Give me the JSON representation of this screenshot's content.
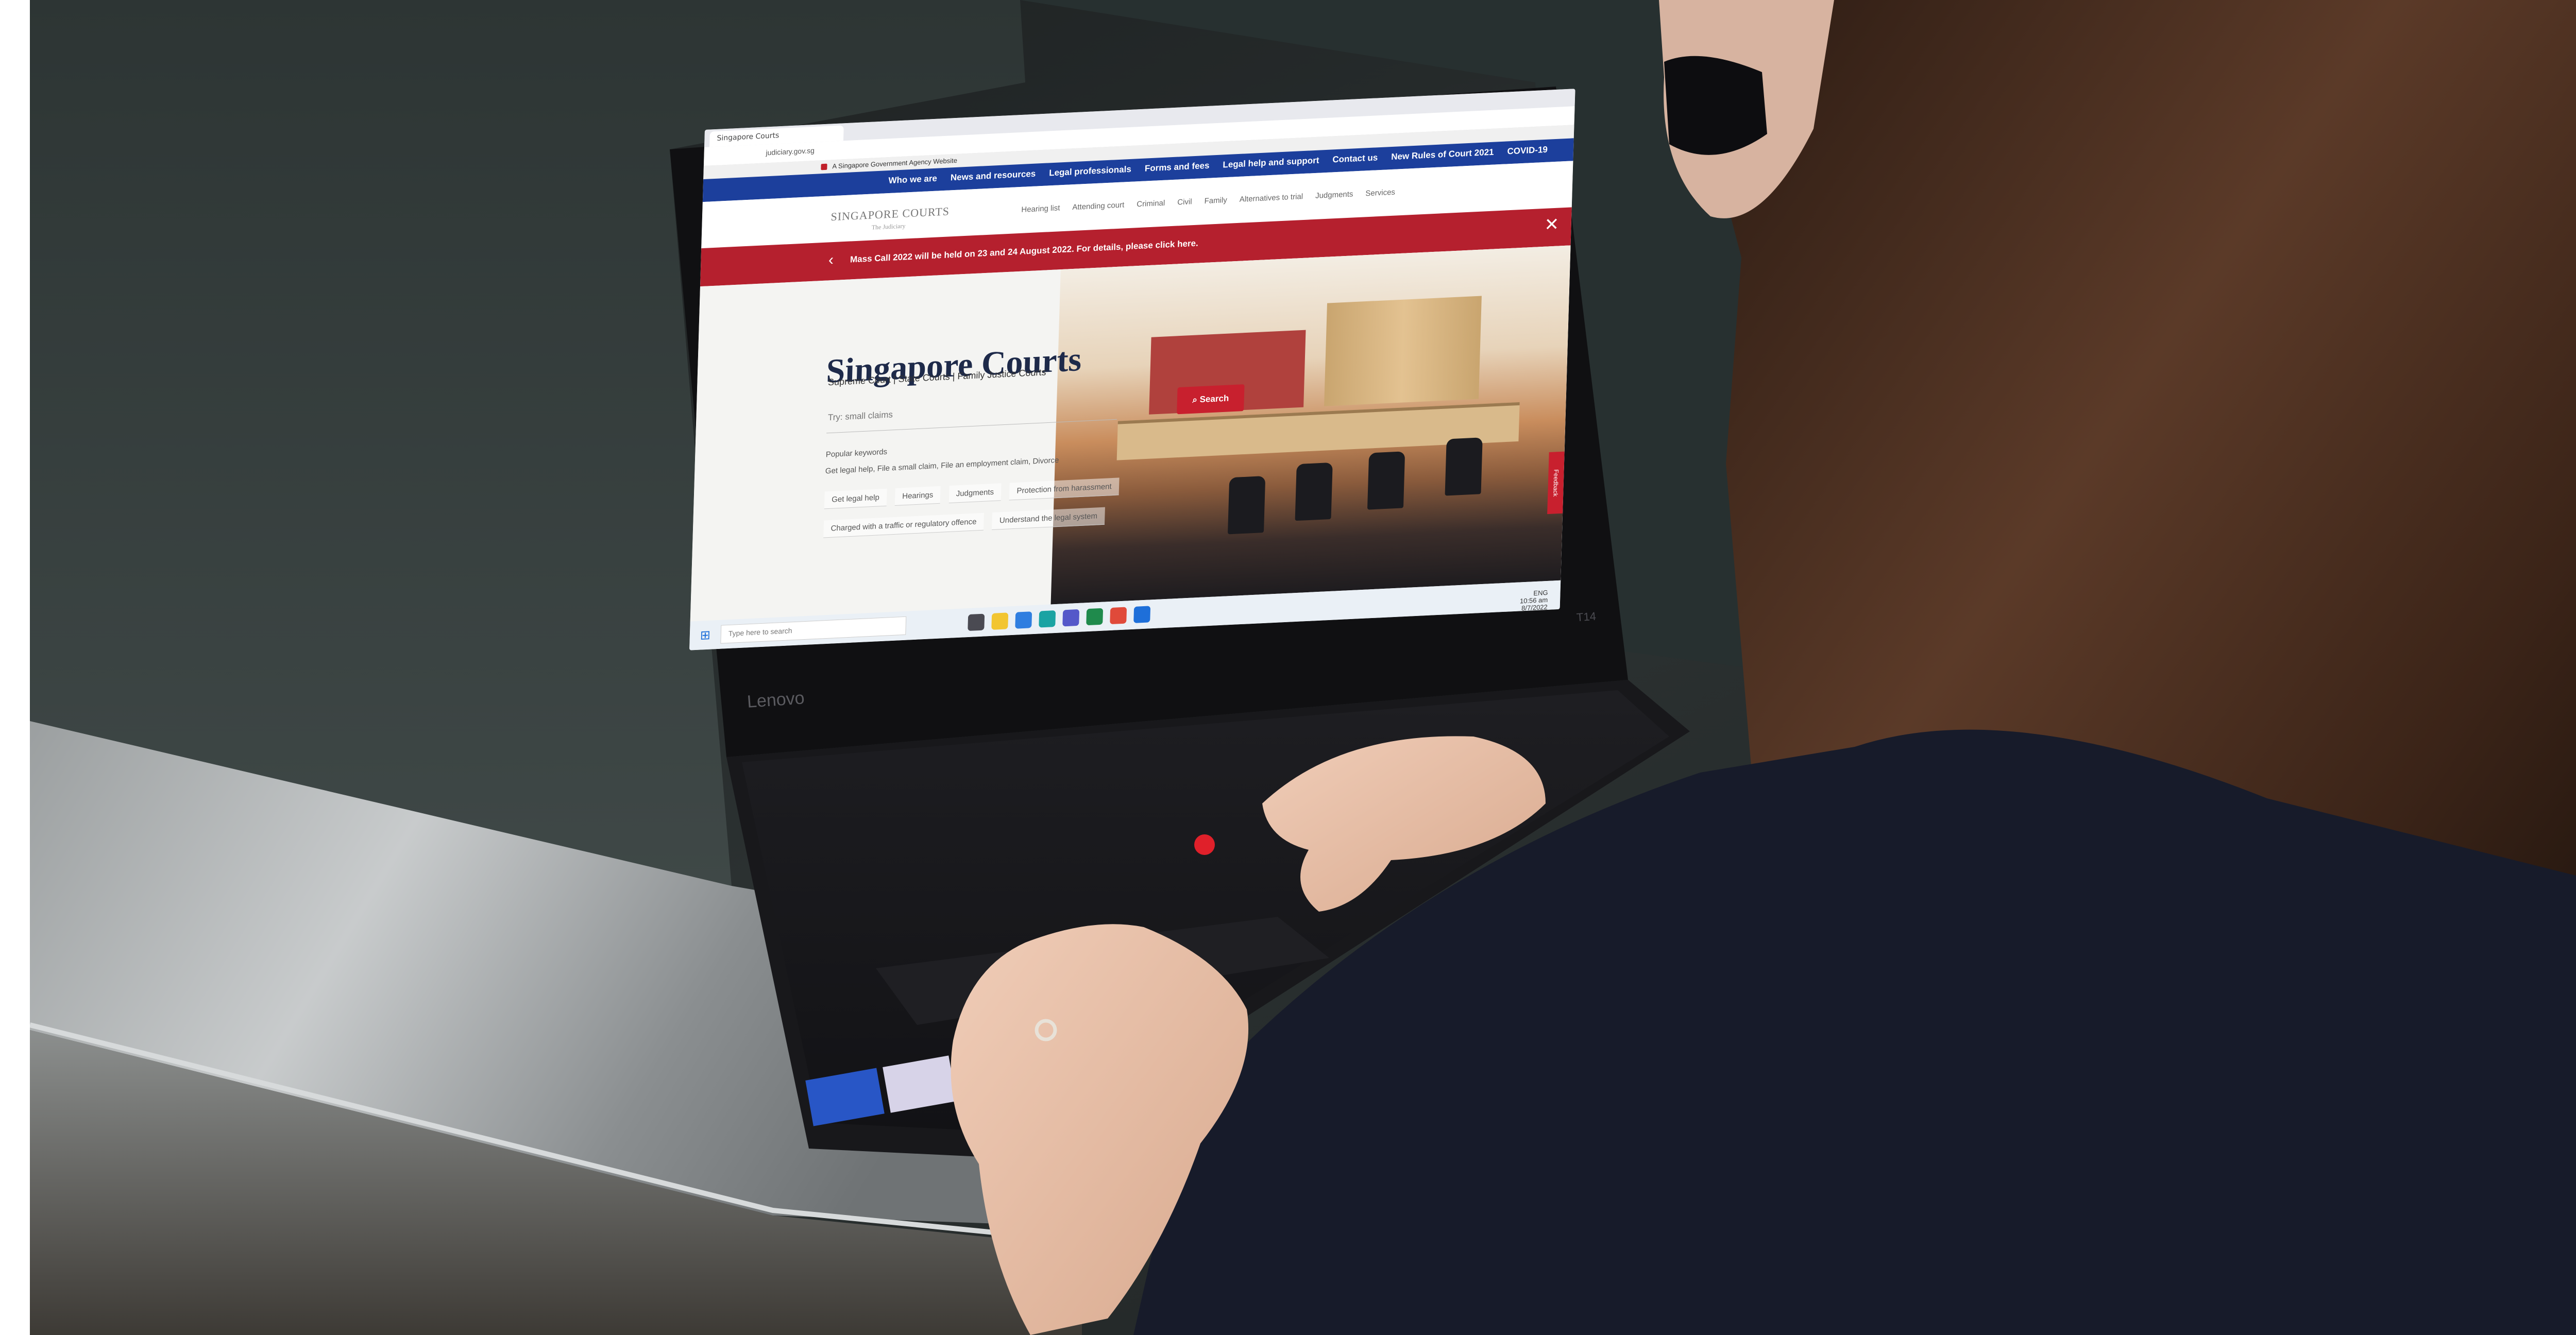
{
  "colors": {
    "nav_blue": "#1c3f9c",
    "brand_red": "#b5202e",
    "hero_title": "#1e2a4a"
  },
  "browser": {
    "tab_title": "Singapore Courts",
    "url": "judiciary.gov.sg"
  },
  "gov_strip": {
    "text": "A Singapore Government Agency Website"
  },
  "top_nav": [
    {
      "label": "Who we are"
    },
    {
      "label": "News and resources"
    },
    {
      "label": "Legal professionals"
    },
    {
      "label": "Forms and fees"
    },
    {
      "label": "Legal help and support"
    },
    {
      "label": "Contact us"
    },
    {
      "label": "New Rules of Court 2021"
    },
    {
      "label": "COVID-19"
    }
  ],
  "header": {
    "logo_text": "SINGAPORE COURTS",
    "logo_sub": "The Judiciary",
    "sub_nav": [
      {
        "label": "Hearing list"
      },
      {
        "label": "Attending court"
      },
      {
        "label": "Criminal"
      },
      {
        "label": "Civil"
      },
      {
        "label": "Family"
      },
      {
        "label": "Alternatives to trial"
      },
      {
        "label": "Judgments"
      },
      {
        "label": "Services"
      }
    ],
    "close_icon": "close-icon"
  },
  "announcement": {
    "message": "Mass Call 2022 will be held on 23 and 24 August 2022. For details, please click here."
  },
  "hero": {
    "title": "Singapore Courts",
    "subtitle": "Supreme Court | State Courts | Family Justice Courts",
    "search_placeholder": "Try: small claims",
    "search_button": "Search",
    "popular_label": "Popular keywords",
    "popular_text": "Get legal help, File a small claim, File an employment claim, Divorce",
    "chips": [
      {
        "label": "Get legal help"
      },
      {
        "label": "Hearings"
      },
      {
        "label": "Judgments"
      },
      {
        "label": "Protection from harassment"
      },
      {
        "label": "Charged with a traffic or regulatory offence"
      },
      {
        "label": "Understand the legal system"
      }
    ],
    "feedback": "Feedback"
  },
  "taskbar": {
    "search_placeholder": "Type here to search",
    "tray_time": "10:56 am",
    "tray_date": "8/7/2022",
    "lang": "ENG"
  },
  "laptop": {
    "brand": "Lenovo",
    "model": "T14"
  }
}
